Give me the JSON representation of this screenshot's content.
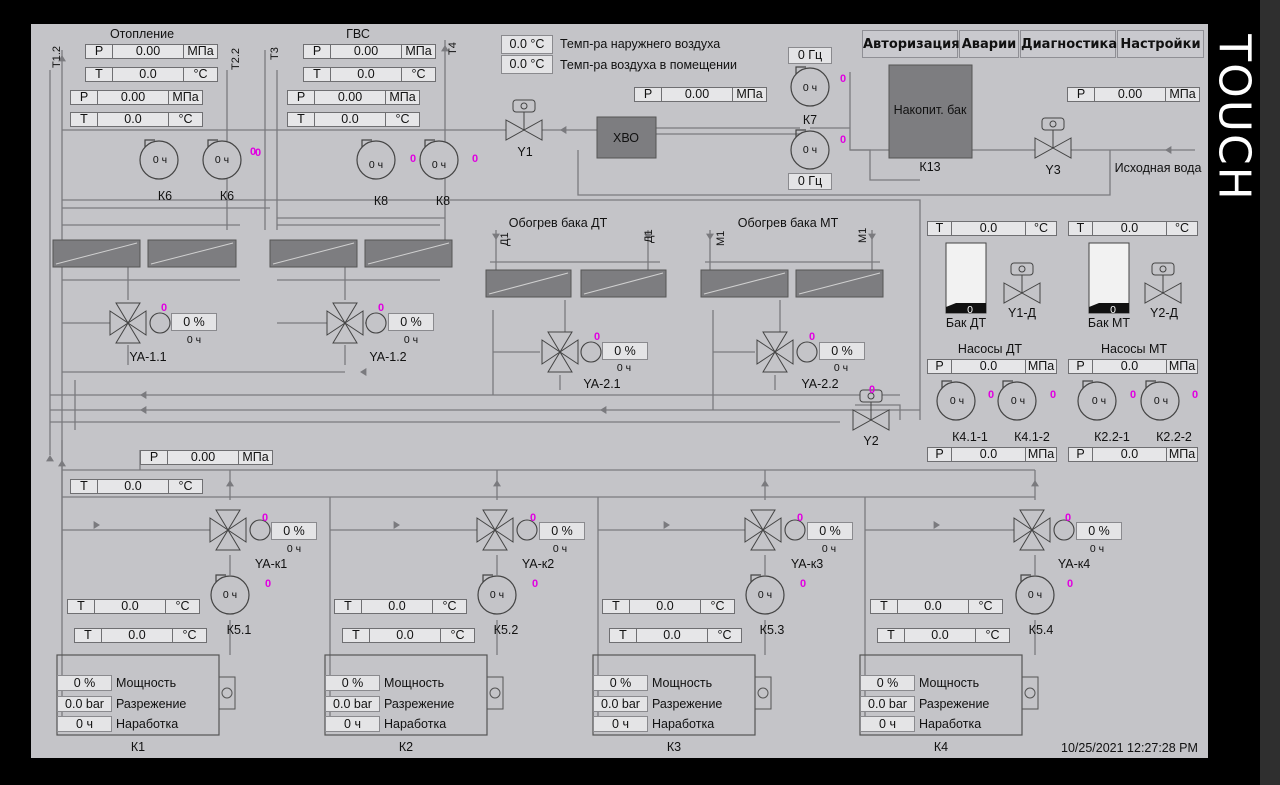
{
  "nav": {
    "auth": "Авторизация",
    "alarms": "Аварии",
    "diag": "Диагностика",
    "settings": "Настройки"
  },
  "brand": "TOUCH",
  "timestamp": "10/25/2021 12:27:28 PM",
  "ambient": {
    "outdoor_value": "0.0 °C",
    "outdoor_label": "Темп-ра наружнего воздуха",
    "indoor_value": "0.0 °C",
    "indoor_label": "Темп-ра воздуха в помещении"
  },
  "units": {
    "p": "P",
    "t": "T",
    "mpa": "МПа",
    "degc": "°C"
  },
  "zero": {
    "p": "0.00",
    "t": "0.0",
    "p2": "0.0"
  },
  "circuits": {
    "heating": "Отопление",
    "dhw": "ГВС",
    "tank_dt": "Обогрев бака ДТ",
    "tank_mt": "Обогрев бака МТ",
    "source_water": "Исходная вода",
    "xvo": "ХВО",
    "storage": "Накопит. бак",
    "k13": "К13"
  },
  "pipes": {
    "t12": "T1.2",
    "t22": "T2.2",
    "t3": "T3",
    "t4": "T4",
    "d1a": "Д1",
    "d1b": "Д1",
    "m1a": "М1",
    "m1b": "М1"
  },
  "freq": {
    "top": "0 Гц",
    "bottom": "0 Гц"
  },
  "hours": "0 ч",
  "percent": "0 %",
  "pump_labels": {
    "k6a": "К6",
    "k6b": "К6",
    "k8a": "К8",
    "k8b": "К8",
    "k7": "К7",
    "k41_1": "К4.1-1",
    "k41_2": "К4.1-2",
    "k22_1": "К2.2-1",
    "k22_2": "К2.2-2",
    "k51": "К5.1",
    "k52": "К5.2",
    "k53": "К5.3",
    "k54": "К5.4"
  },
  "valve_labels": {
    "y1": "Y1",
    "y2": "Y2",
    "y3": "Y3",
    "y1d": "Y1-Д",
    "y2d": "Y2-Д",
    "ya11": "YA-1.1",
    "ya12": "YA-1.2",
    "ya21": "YA-2.1",
    "ya22": "YA-2.2",
    "yak1": "YA-к1",
    "yak2": "YA-к2",
    "yak3": "YA-к3",
    "yak4": "YA-к4"
  },
  "tanks": {
    "dt": "Бак ДТ",
    "mt": "Бак МТ",
    "level": "0"
  },
  "pump_groups": {
    "dt": "Насосы ДТ",
    "mt": "Насосы МТ"
  },
  "zero_mark": "0",
  "boilers": {
    "power_label": "Мощность",
    "draft_label": "Разрежение",
    "hours_label": "Наработка",
    "power": "0 %",
    "draft": "0.0 bar",
    "hours": "0 ч",
    "names": [
      "К1",
      "К2",
      "К3",
      "К4"
    ]
  },
  "colors": {
    "screen": "#c4c4c8",
    "line": "#7a7a7e",
    "equipment": "#7d7d80",
    "alarm_pink": "#e000e0"
  }
}
